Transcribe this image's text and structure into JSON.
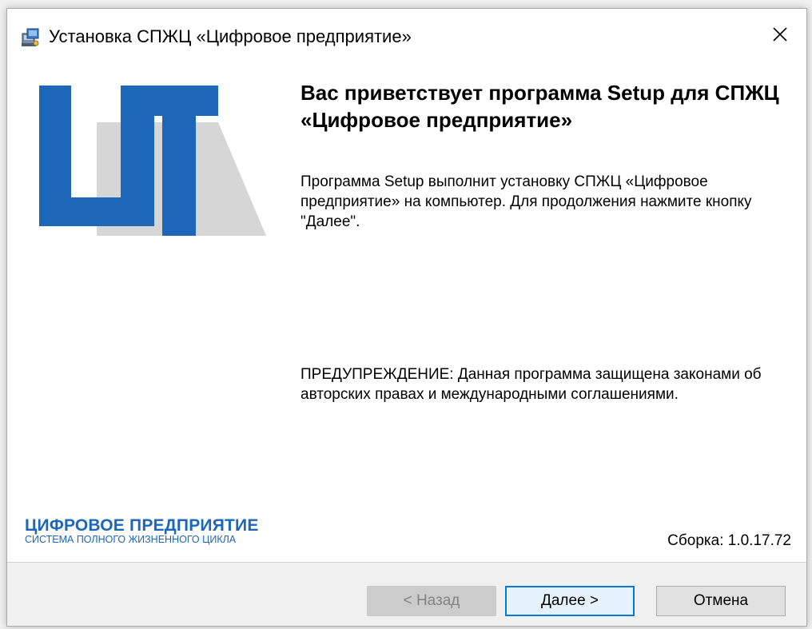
{
  "window": {
    "title": "Установка СПЖЦ «Цифровое предприятие»"
  },
  "welcome": {
    "heading": "Вас приветствует программа Setup для СПЖЦ «Цифровое предприятие»",
    "intro": "Программа Setup выполнит установку СПЖЦ «Цифровое предприятие» на компьютер. Для продолжения нажмите кнопку \"Далее\".",
    "warning": "ПРЕДУПРЕЖДЕНИЕ: Данная программа защищена законами об авторских правах и международными соглашениями."
  },
  "brand": {
    "name": "ЦИФРОВОЕ ПРЕДПРИЯТИЕ",
    "subtitle": "СИСТЕМА ПОЛНОГО ЖИЗНЕННОГО ЦИКЛА"
  },
  "build": {
    "label": "Сборка: 1.0.17.72"
  },
  "buttons": {
    "back": "< Назад",
    "next": "Далее >",
    "cancel": "Отмена"
  },
  "icons": {
    "app": "installer-icon",
    "close": "close-icon",
    "logo": "company-logo-icon"
  },
  "colors": {
    "brand_blue": "#1c67b8",
    "logo_gray": "#d6d6d6",
    "accent_focus": "#0078d7"
  }
}
